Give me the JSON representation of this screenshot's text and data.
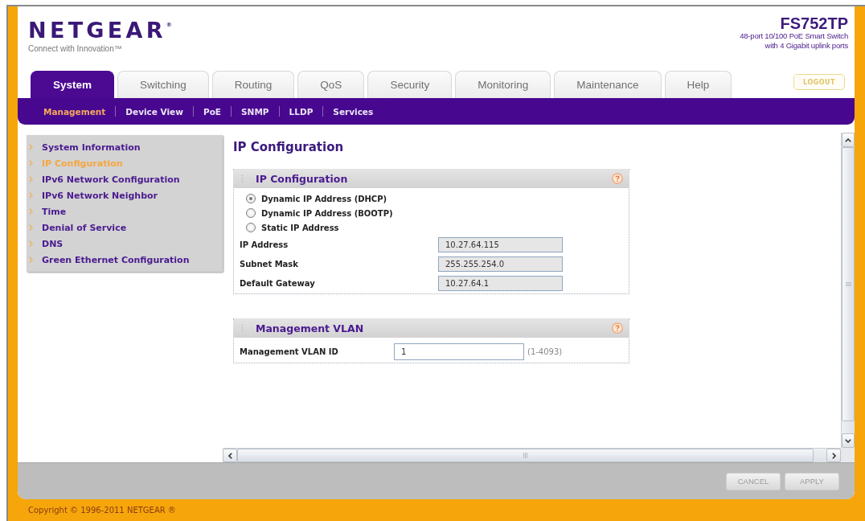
{
  "header": {
    "logo": "NETGEAR$^{®}$",
    "tagline": "Connect with Innovation™",
    "model": "FS752TP",
    "description": [
      "48-port 10/100 PoE Smart Switch",
      "with 4 Gigabit uplink ports"
    ]
  },
  "tabs": [
    {
      "label": "System",
      "selected": true
    },
    {
      "label": "Switching",
      "selected": false
    },
    {
      "label": "Routing",
      "selected": false
    },
    {
      "label": "QoS",
      "selected": false
    },
    {
      "label": "Security",
      "selected": false
    },
    {
      "label": "Monitoring",
      "selected": false
    },
    {
      "label": "Maintenance",
      "selected": false
    },
    {
      "label": "Help",
      "selected": false
    }
  ],
  "logout_button": "LOGOUT",
  "subtabs": [
    {
      "label": "Management",
      "selected": true
    },
    {
      "label": "Device View",
      "selected": false
    },
    {
      "label": "PoE",
      "selected": false
    },
    {
      "label": "SNMP",
      "selected": false
    },
    {
      "label": "LLDP",
      "selected": false
    },
    {
      "label": "Services",
      "selected": false
    }
  ],
  "sidebar": {
    "items": [
      {
        "label": "System Information",
        "selected": false
      },
      {
        "label": "IP Configuration",
        "selected": true
      },
      {
        "label": "IPv6 Network Configuration",
        "selected": false
      },
      {
        "label": "IPv6 Network Neighbor",
        "selected": false
      },
      {
        "label": "Time",
        "selected": false
      },
      {
        "label": "Denial of Service",
        "selected": false
      },
      {
        "label": "DNS",
        "selected": false
      },
      {
        "label": "Green Ethernet Configuration",
        "selected": false
      }
    ]
  },
  "page_title": "IP Configuration",
  "panels": [
    {
      "title": "IP Configuration",
      "options": [
        {
          "label": "Dynamic IP Address (DHCP)",
          "selected": true
        },
        {
          "label": "Dynamic IP Address (BOOTP)",
          "selected": false
        },
        {
          "label": "Static IP Address",
          "selected": false
        }
      ],
      "fields": [
        {
          "label": "IP Address",
          "value": "10.27.64.115",
          "disabled": true
        },
        {
          "label": "Subnet Mask",
          "value": "255.255.254.0",
          "disabled": true
        },
        {
          "label": "Default Gateway",
          "value": "10.27.64.1",
          "disabled": true
        }
      ]
    },
    {
      "title": "Management VLAN",
      "fields": [
        {
          "label": "Management VLAN ID",
          "value": "1",
          "hint": "(1-4093)",
          "disabled": false
        }
      ]
    }
  ],
  "buttons": [
    "CANCEL",
    "APPLY"
  ],
  "copyright": "Copyright © 1996-2011 NETGEAR ®"
}
